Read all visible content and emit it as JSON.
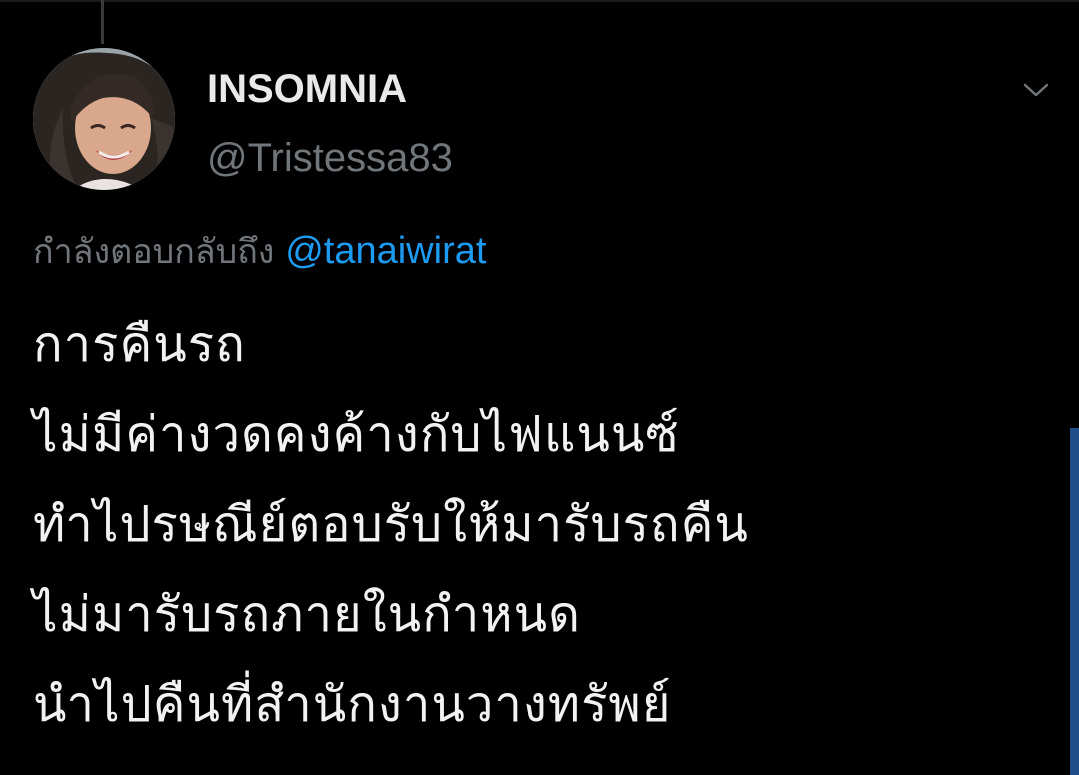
{
  "colors": {
    "background": "#000000",
    "primary_text": "#e7e9ea",
    "secondary_text": "#71767b",
    "accent": "#1d9bf0",
    "scrollbar": "#1f4e8a"
  },
  "tweet": {
    "author": {
      "display_name": "INSOMNIA",
      "handle": "@Tristessa83",
      "avatar_icon": "profile-photo-avatar"
    },
    "menu_icon": "chevron-down-icon",
    "reply_context": {
      "prefix": "กำลังตอบกลับถึง",
      "mention": "@tanaiwirat"
    },
    "text_lines": [
      "การคืนรถ",
      "ไม่มีค่างวดคงค้างกับไฟแนนซ์",
      "ทำไปรษณีย์ตอบรับให้มารับรถคืน",
      "ไม่มารับรถภายในกำหนด",
      "นำไปคืนที่สำนักงานวางทรัพย์"
    ]
  }
}
